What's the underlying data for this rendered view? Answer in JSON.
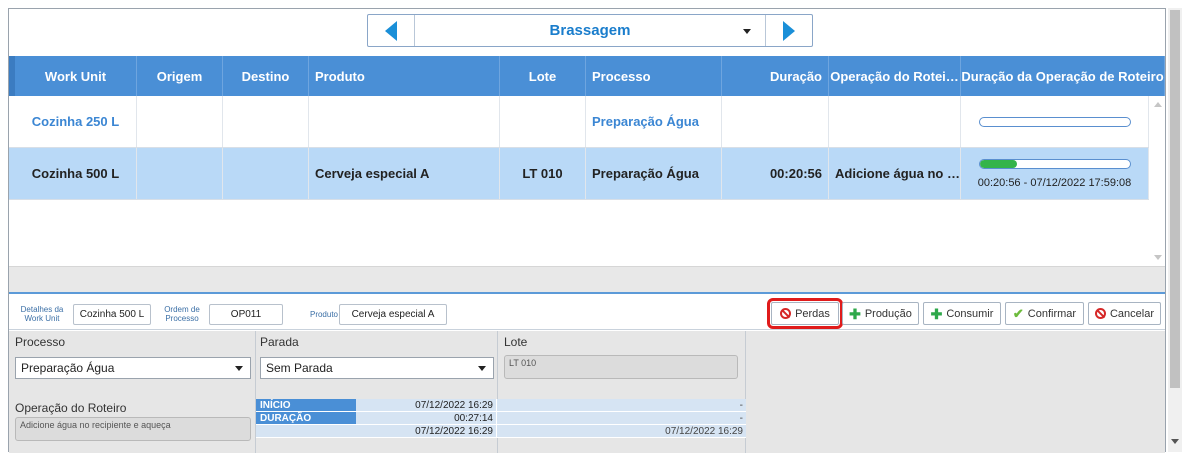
{
  "selector": {
    "value": "Brassagem"
  },
  "columns": [
    "Work Unit",
    "Origem",
    "Destino",
    "Produto",
    "Lote",
    "Processo",
    "Duração",
    "Operação do Rotei…",
    "Duração da Operação de Roteiro"
  ],
  "rows": [
    {
      "work_unit": "Cozinha 250 L",
      "origem": "",
      "destino": "",
      "produto": "",
      "lote": "",
      "processo": "Preparação Água",
      "duracao": "",
      "operacao": "",
      "progress": 0,
      "progress_text": ""
    },
    {
      "work_unit": "Cozinha 500 L",
      "origem": "",
      "destino": "",
      "produto": "Cerveja especial A",
      "lote": "LT 010",
      "processo": "Preparação Água",
      "duracao": "00:20:56",
      "operacao": "Adicione água no …",
      "progress": 0.25,
      "progress_text": "00:20:56 - 07/12/2022 17:59:08"
    }
  ],
  "details": {
    "work_unit_label_1": "Detalhes da",
    "work_unit_label_2": "Work Unit",
    "work_unit_value": "Cozinha 500 L",
    "ordem_label_1": "Ordem de",
    "ordem_label_2": "Processo",
    "ordem_value": "OP011",
    "produto_label": "Produto",
    "produto_value": "Cerveja especial A"
  },
  "actions": {
    "perdas": "Perdas",
    "producao": "Produção",
    "consumir": "Consumir",
    "confirmar": "Confirmar",
    "cancelar": "Cancelar"
  },
  "form": {
    "processo_label": "Processo",
    "processo_value": "Preparação Água",
    "operacao_label": "Operação do Roteiro",
    "operacao_value": "Adicione água no recipiente e aqueça",
    "parada_label": "Parada",
    "parada_value": "Sem Parada",
    "lote_label": "Lote",
    "lote_value": "LT 010",
    "inicio_label": "INÍCIO",
    "inicio_value": "07/12/2022 16:29",
    "inicio_value2": "-",
    "duracao_label": "DURAÇÃO",
    "duracao_value": "00:27:14",
    "duracao_value2": "-",
    "fim_value": "07/12/2022 16:29",
    "fim_value2": "07/12/2022 16:29"
  },
  "colors": {
    "header": "#4a8fd6",
    "selected_row": "#b9d9f7",
    "link": "#3b86d3",
    "highlight": "#e01b1b",
    "progress": "#34b44a"
  }
}
